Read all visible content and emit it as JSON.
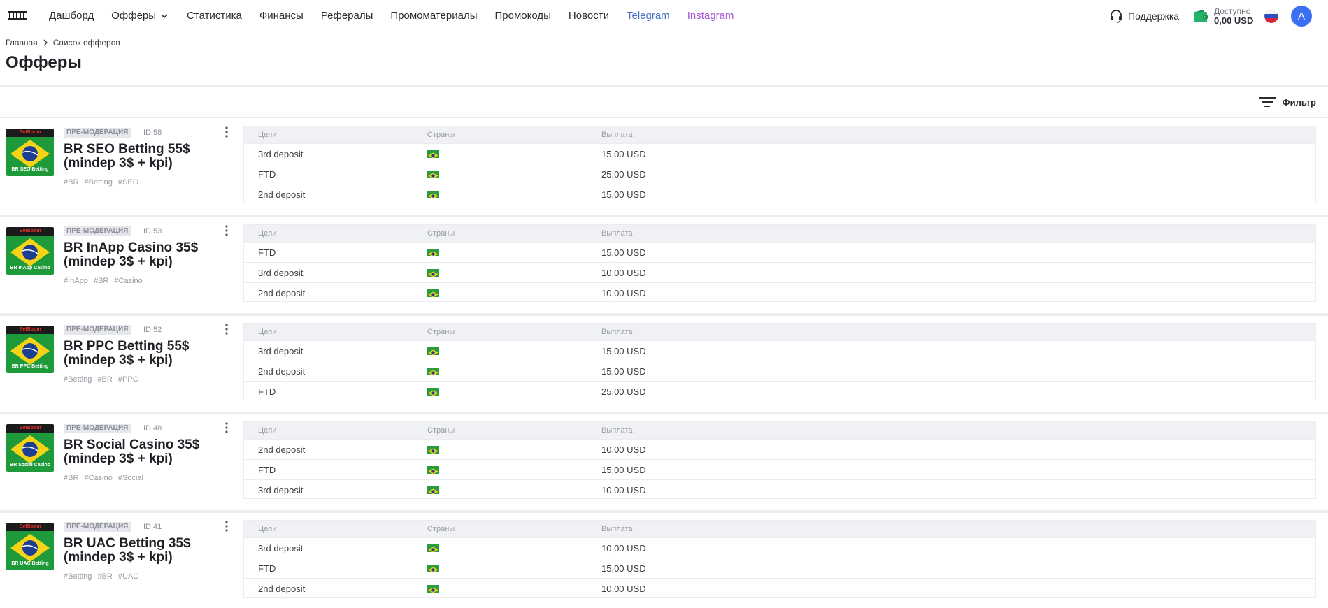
{
  "nav": {
    "items": [
      "Дашборд",
      "Офферы",
      "Статистика",
      "Финансы",
      "Рефералы",
      "Промоматериалы",
      "Промокоды",
      "Новости",
      "Telegram",
      "Instagram"
    ],
    "icons": {
      "logo": "logo-icon",
      "offers_dropdown": "chevron-down-icon"
    }
  },
  "header": {
    "support_label": "Поддержка",
    "balance_label": "Доступно",
    "balance_value": "0,00 USD",
    "avatar_letter": "A",
    "colors": {
      "telegram": "#4a72c6",
      "instagram": "#a45ad0",
      "avatar": "#3d6ff2",
      "wallet": "#21b26b"
    }
  },
  "breadcrumb": {
    "home": "Главная",
    "current": "Список офферов"
  },
  "page": {
    "title": "Офферы",
    "filter_label": "Фильтр"
  },
  "table_headers": {
    "goals": "Цели",
    "countries": "Страны",
    "payout": "Выплата"
  },
  "offers": [
    {
      "badge": "ПРЕ-МОДЕРАЦИЯ",
      "id": "ID 58",
      "title": "BR SEO Betting 55$ (mindep 3$ + kpi)",
      "brand": "BetBoom",
      "caption": "BR SEO Betting",
      "tags": [
        "#BR",
        "#Betting",
        "#SEO"
      ],
      "rows": [
        {
          "goal": "3rd deposit",
          "payout": "15,00 USD"
        },
        {
          "goal": "FTD",
          "payout": "25,00 USD"
        },
        {
          "goal": "2nd deposit",
          "payout": "15,00 USD"
        }
      ]
    },
    {
      "badge": "ПРЕ-МОДЕРАЦИЯ",
      "id": "ID 53",
      "title": "BR InApp Casino 35$ (mindep 3$ + kpi)",
      "brand": "BetBoom",
      "caption": "BR InApp Casino",
      "tags": [
        "#InApp",
        "#BR",
        "#Casino"
      ],
      "rows": [
        {
          "goal": "FTD",
          "payout": "15,00 USD"
        },
        {
          "goal": "3rd deposit",
          "payout": "10,00 USD"
        },
        {
          "goal": "2nd deposit",
          "payout": "10,00 USD"
        }
      ]
    },
    {
      "badge": "ПРЕ-МОДЕРАЦИЯ",
      "id": "ID 52",
      "title": "BR PPC Betting 55$ (mindep 3$ + kpi)",
      "brand": "BetBoom",
      "caption": "BR PPC Betting",
      "tags": [
        "#Betting",
        "#BR",
        "#PPC"
      ],
      "rows": [
        {
          "goal": "3rd deposit",
          "payout": "15,00 USD"
        },
        {
          "goal": "2nd deposit",
          "payout": "15,00 USD"
        },
        {
          "goal": "FTD",
          "payout": "25,00 USD"
        }
      ]
    },
    {
      "badge": "ПРЕ-МОДЕРАЦИЯ",
      "id": "ID 48",
      "title": "BR Social Casino 35$ (mindep 3$ + kpi)",
      "brand": "BetBoom",
      "caption": "BR Social Casino",
      "tags": [
        "#BR",
        "#Casino",
        "#Social"
      ],
      "rows": [
        {
          "goal": "2nd deposit",
          "payout": "10,00 USD"
        },
        {
          "goal": "FTD",
          "payout": "15,00 USD"
        },
        {
          "goal": "3rd deposit",
          "payout": "10,00 USD"
        }
      ]
    },
    {
      "badge": "ПРЕ-МОДЕРАЦИЯ",
      "id": "ID 41",
      "title": "BR UAC Betting 35$ (mindep 3$ + kpi)",
      "brand": "BetBoom",
      "caption": "BR UAC Betting",
      "tags": [
        "#Betting",
        "#BR",
        "#UAC"
      ],
      "rows": [
        {
          "goal": "3rd deposit",
          "payout": "10,00 USD"
        },
        {
          "goal": "FTD",
          "payout": "15,00 USD"
        },
        {
          "goal": "2nd deposit",
          "payout": "10,00 USD"
        }
      ]
    }
  ]
}
